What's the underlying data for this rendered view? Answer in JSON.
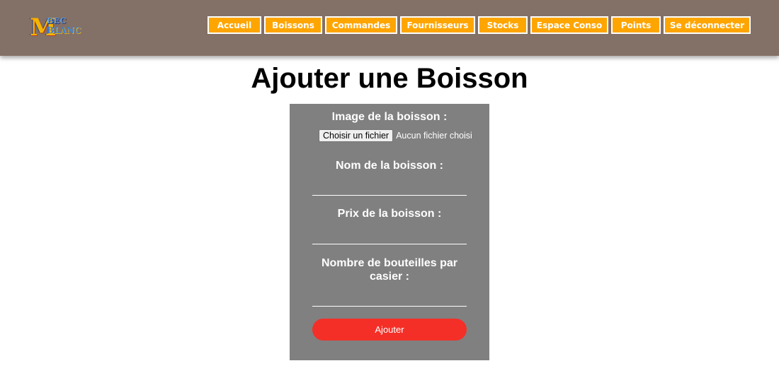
{
  "header": {
    "logo": {
      "letter": "M",
      "line1": "BEC",
      "line2": "BLANC"
    },
    "nav": [
      {
        "label": "Accueil",
        "key": "accueil"
      },
      {
        "label": "Boissons",
        "key": "boissons"
      },
      {
        "label": "Commandes",
        "key": "commandes"
      },
      {
        "label": "Fournisseurs",
        "key": "fournisseurs"
      },
      {
        "label": "Stocks",
        "key": "stocks"
      },
      {
        "label": "Espace Conso",
        "key": "espace-conso"
      },
      {
        "label": "Points",
        "key": "points"
      },
      {
        "label": "Se déconnecter",
        "key": "se-deconnecter"
      }
    ]
  },
  "main": {
    "title": "Ajouter une Boisson"
  },
  "form": {
    "image_label": "Image de la boisson :",
    "file_button_label": "Choisir un fichier",
    "file_status": "Aucun fichier choisi",
    "name_label": "Nom de la boisson :",
    "name_value": "",
    "price_label": "Prix de la boisson :",
    "price_value": "",
    "bottles_label": "Nombre de bouteilles par casier :",
    "bottles_value": "",
    "submit_label": "Ajouter"
  },
  "colors": {
    "header_bg": "#837066",
    "nav_button": "#ffa500",
    "form_bg": "#808080",
    "submit_button": "#f42f27"
  }
}
